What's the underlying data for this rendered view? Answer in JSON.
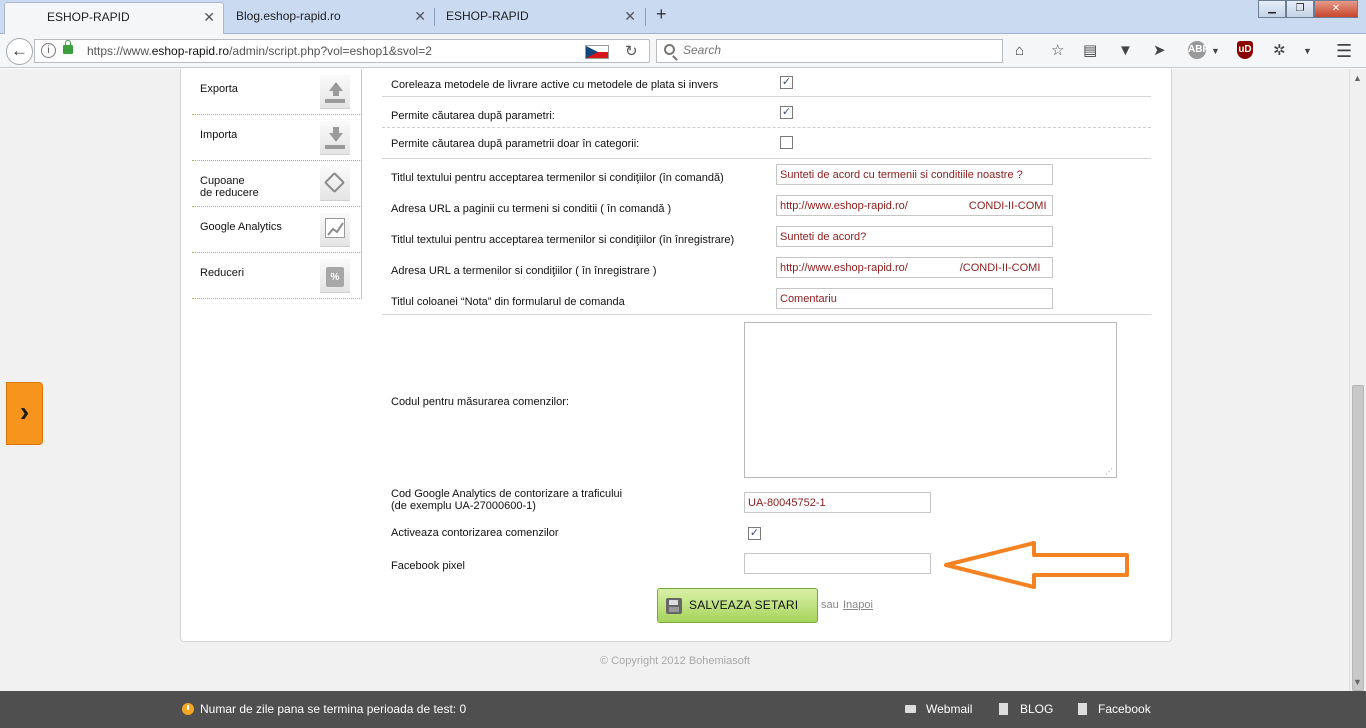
{
  "browser": {
    "tabs": [
      {
        "label": "ESHOP-RAPID",
        "active": true
      },
      {
        "label": "Blog.eshop-rapid.ro",
        "active": false
      },
      {
        "label": "ESHOP-RAPID",
        "active": false
      }
    ],
    "new_tab": "+",
    "url_prefix": "https://www.",
    "url_host": "eshop-rapid.ro",
    "url_path": "/admin/script.php?vol=eshop1&svol=2",
    "search_placeholder": "Search"
  },
  "sidebar": {
    "items": [
      {
        "label": "Exporta",
        "icon": "export-icon"
      },
      {
        "label": "Importa",
        "icon": "import-icon"
      },
      {
        "label_line1": "Cupoane",
        "label_line2": "de reducere",
        "icon": "coupon-tag-icon"
      },
      {
        "label": "Google Analytics",
        "icon": "analytics-chart-icon"
      },
      {
        "label": "Reduceri",
        "icon": "discount-bag-icon",
        "icon_text": "%"
      }
    ]
  },
  "form": {
    "correlate_label": "Coreleaza metodele de livrare active cu metodele de plata si invers",
    "correlate_checked": true,
    "param_search_label": "Permite căutarea după parametri:",
    "param_search_checked": true,
    "param_search_cat_label": "Permite căutarea după parametrii doar în categorii:",
    "param_search_cat_checked": false,
    "terms_text_order_label": "Titlul textului pentru acceptarea termenilor si condiţiilor (în comandă)",
    "terms_text_order_value": "Sunteti de acord cu termenii si conditiile noastre ?",
    "terms_url_order_label": "Adresa URL a paginii cu termeni si conditii ( în comandă )",
    "terms_url_order_value": "http://www.eshop-rapid.ro/                    CONDI-II-COMI",
    "terms_text_reg_label": "Titlul textului pentru acceptarea termenilor si condiţiilor (în înregistrare)",
    "terms_text_reg_value": "Sunteti de acord?",
    "terms_url_reg_label": "Adresa URL a termenilor si condiţiilor  ( în înregistrare )",
    "terms_url_reg_value": "http://www.eshop-rapid.ro/                 /CONDI-II-COMI",
    "note_column_label": "Titlul coloanei “Nota” din formularul de comanda",
    "note_column_value": "Comentariu",
    "tracking_code_label": "Codul pentru măsurarea comenzilor:",
    "tracking_code_value": "",
    "ga_code_label_line1": "Cod Google Analytics de contorizare a traficului",
    "ga_code_label_line2": "(de exemplu UA-27000600-1)",
    "ga_code_value": "UA-80045752-1",
    "order_tracking_label": "Activeaza contorizarea comenzilor",
    "order_tracking_checked": true,
    "fb_pixel_label": "Facebook pixel",
    "fb_pixel_value": ""
  },
  "actions": {
    "save_label": "SALVEAZA SETARI",
    "or_text": "sau",
    "back_label": "Inapoi"
  },
  "copyright": "© Copyright 2012 Bohemiasoft",
  "footer": {
    "trial_text": "Numar de zile pana se termina perioada de test: 0",
    "webmail": "Webmail",
    "blog": "BLOG",
    "facebook": "Facebook"
  },
  "colors": {
    "accent_orange": "#f7941d",
    "save_green": "#a6d45b",
    "footer_bg": "#4f4f4f",
    "input_text": "#8a1c1c",
    "annotation_arrow": "#f58220"
  }
}
